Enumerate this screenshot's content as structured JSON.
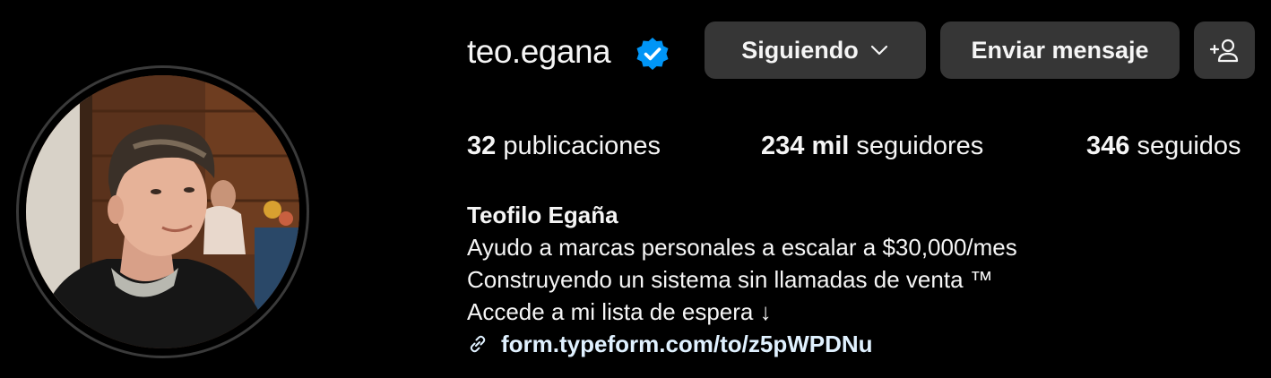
{
  "profile": {
    "username": "teo.egana",
    "verified_icon": "verified-badge-icon",
    "buttons": {
      "following_label": "Siguiendo",
      "message_label": "Enviar mensaje",
      "add_user_icon": "add-user-icon"
    },
    "stats": {
      "posts_value": "32",
      "posts_label": "publicaciones",
      "followers_value": "234 mil",
      "followers_label": "seguidores",
      "following_value": "346",
      "following_label": "seguidos"
    },
    "bio": {
      "name": "Teofilo Egaña",
      "lines": [
        "Ayudo a marcas personales a escalar a $30,000/mes",
        "Construyendo un sistema sin llamadas de venta ™",
        "Accede a mi lista de espera ↓"
      ],
      "link": "form.typeform.com/to/z5pWPDNu"
    }
  },
  "colors": {
    "background": "#000000",
    "button_bg": "#363636",
    "verified_blue": "#0095f6",
    "link": "#e0f1ff"
  }
}
